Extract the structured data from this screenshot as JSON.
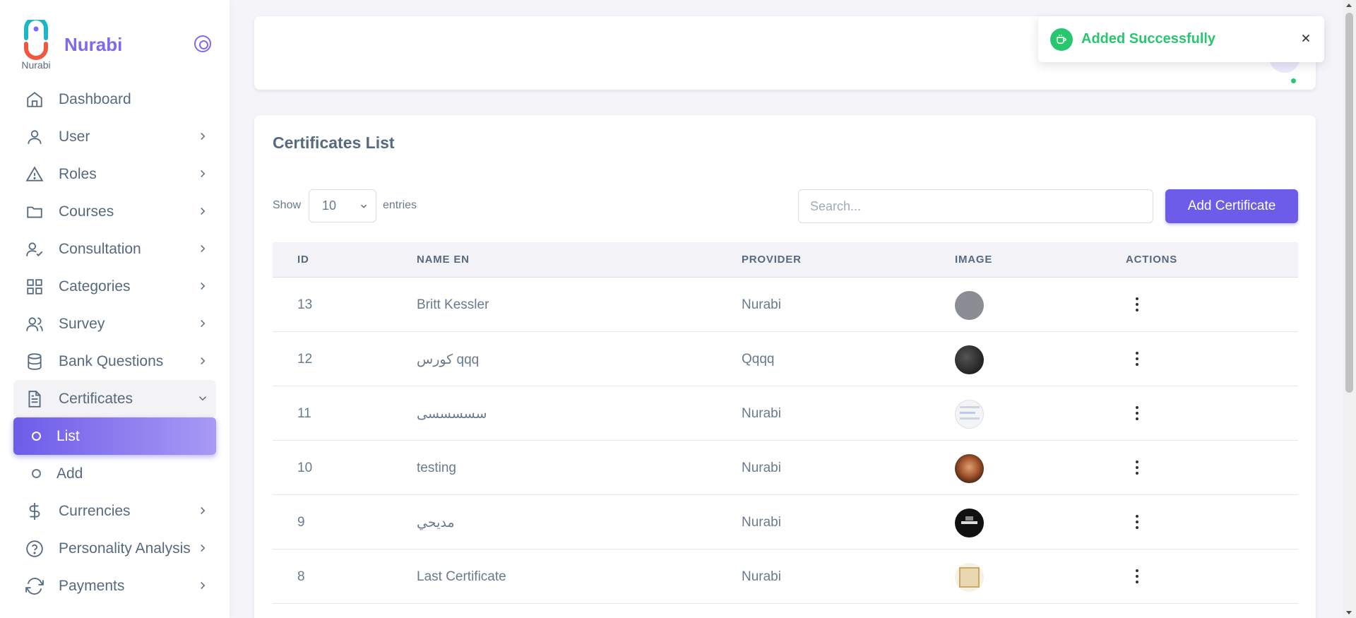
{
  "brand": {
    "name": "Nurabi",
    "logo_text": "Nurabi",
    "primary_color": "#7c6bf1"
  },
  "sidebar": {
    "items": [
      {
        "label": "Dashboard",
        "icon": "home-icon",
        "has_chevron": false
      },
      {
        "label": "User",
        "icon": "user-icon",
        "has_chevron": true
      },
      {
        "label": "Roles",
        "icon": "alert-triangle-icon",
        "has_chevron": true
      },
      {
        "label": "Courses",
        "icon": "folder-icon",
        "has_chevron": true
      },
      {
        "label": "Consultation",
        "icon": "user-check-icon",
        "has_chevron": true
      },
      {
        "label": "Categories",
        "icon": "grid-icon",
        "has_chevron": true
      },
      {
        "label": "Survey",
        "icon": "users-icon",
        "has_chevron": true
      },
      {
        "label": "Bank Questions",
        "icon": "database-icon",
        "has_chevron": true
      },
      {
        "label": "Certificates",
        "icon": "file-text-icon",
        "has_chevron": true,
        "open": true
      },
      {
        "label": "Currencies",
        "icon": "dollar-icon",
        "has_chevron": true
      },
      {
        "label": "Personality Analysis",
        "icon": "help-circle-icon",
        "has_chevron": true
      },
      {
        "label": "Payments",
        "icon": "refresh-icon",
        "has_chevron": true
      }
    ],
    "certificates_sub": [
      {
        "label": "List",
        "active": true
      },
      {
        "label": "Add",
        "active": false
      }
    ]
  },
  "toast": {
    "message": "Added Successfully",
    "color": "#28c76f"
  },
  "card": {
    "title": "Certificates List",
    "show_label": "Show",
    "entries_value": "10",
    "entries_label": "entries",
    "search_placeholder": "Search...",
    "add_button": "Add Certificate"
  },
  "table": {
    "columns": [
      "ID",
      "NAME EN",
      "PROVIDER",
      "IMAGE",
      "ACTIONS"
    ],
    "rows": [
      {
        "id": "13",
        "name": "Britt Kessler",
        "provider": "Nurabi",
        "image": "gray-circle"
      },
      {
        "id": "12",
        "name": "كورس qqq",
        "provider": "Qqqq",
        "image": "dark-photo"
      },
      {
        "id": "11",
        "name": "سسسسسی",
        "provider": "Nurabi",
        "image": "screenshot-thumb"
      },
      {
        "id": "10",
        "name": "testing",
        "provider": "Nurabi",
        "image": "portrait-photo"
      },
      {
        "id": "9",
        "name": "مديحي",
        "provider": "Nurabi",
        "image": "black-logo"
      },
      {
        "id": "8",
        "name": "Last Certificate",
        "provider": "Nurabi",
        "image": "certificate-paper"
      }
    ]
  }
}
